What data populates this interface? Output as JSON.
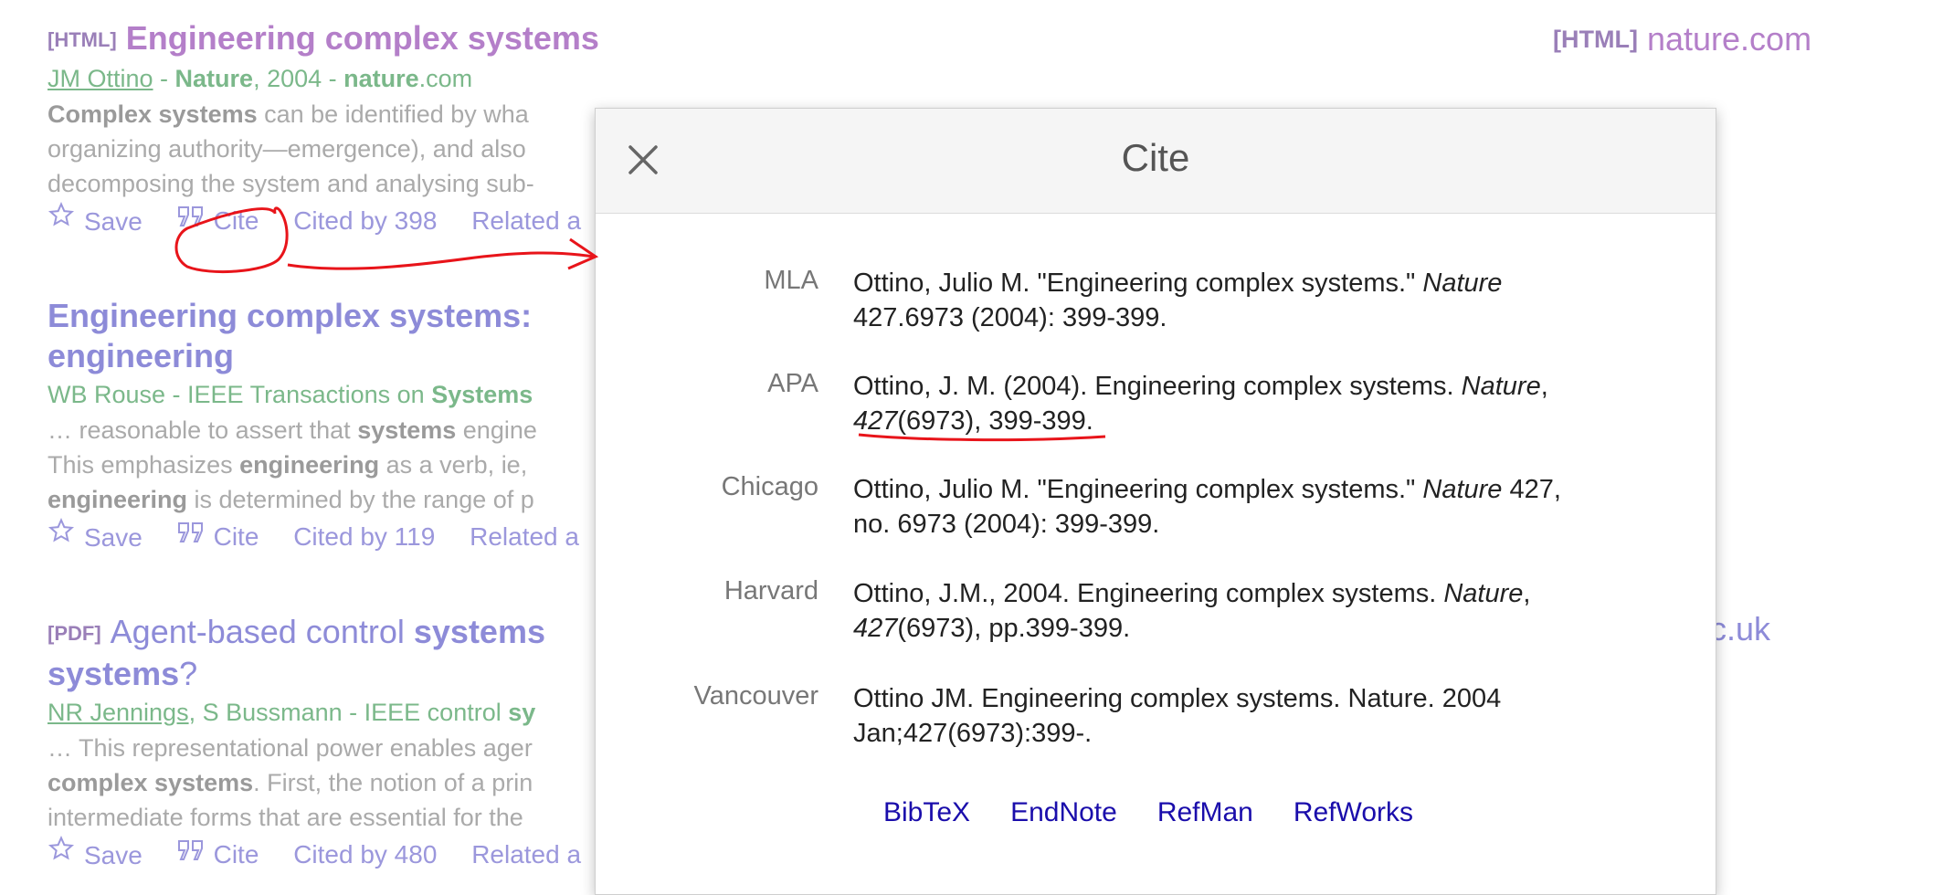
{
  "results": [
    {
      "tag": "[HTML]",
      "title": "Engineering complex systems",
      "author": "JM Ottino",
      "source_pre": " - ",
      "source_journal": "Nature",
      "source_year": ", 2004 - ",
      "source_domain_bold": "nature",
      "source_domain_rest": ".com",
      "snippet": [
        {
          "bold": "Complex systems",
          "text": " can be identified by wha"
        },
        {
          "bold": "",
          "text": "organizing authority—emergence), and also"
        },
        {
          "bold": "",
          "text": "decomposing the system and analysing sub-"
        }
      ],
      "save": "Save",
      "cite": "Cite",
      "cited_by": "Cited by 398",
      "related": "Related a",
      "side_tag": "[HTML]",
      "side_text": "nature.com"
    },
    {
      "title_line1": "Engineering complex systems:",
      "title_line2": "engineering",
      "meta_plain": "WB Rouse - IEEE Transactions on ",
      "meta_bold": "Systems",
      "snippet": [
        {
          "pre": "… reasonable to assert that ",
          "bold": "systems",
          "post": " engine"
        },
        {
          "pre": "This emphasizes ",
          "bold": "engineering",
          "post": " as a verb, ie,"
        },
        {
          "pre": "",
          "bold": "engineering",
          "post": " is determined by the range of p"
        }
      ],
      "save": "Save",
      "cite": "Cite",
      "cited_by": "Cited by 119",
      "related": "Related a"
    },
    {
      "tag": "[PDF]",
      "title_pre": "Agent-based control ",
      "title_bold": "systems",
      "title_line2_bold": "systems",
      "title_line2_rest": "?",
      "author1": "NR Jennings",
      "meta_rest": ", S Bussmann - IEEE control ",
      "meta_bold": "sy",
      "snippet": [
        {
          "pre": "… This representational power enables ager",
          "bold": "",
          "post": ""
        },
        {
          "pre": "",
          "bold": "complex systems",
          "post": ". First, the notion of a prin"
        },
        {
          "pre": "intermediate forms that are essential for the",
          "bold": "",
          "post": ""
        }
      ],
      "save": "Save",
      "cite": "Cite",
      "cited_by": "Cited by 480",
      "related": "Related a",
      "side_text": "ac.uk"
    }
  ],
  "dialog": {
    "title": "Cite",
    "citations": [
      {
        "style": "MLA",
        "l1a": "Ottino, Julio M. \"Engineering complex systems.\" ",
        "l1i": "Nature",
        "l1b": "",
        "l2i": "",
        "l2a": "427.6973 (2004): 399-399."
      },
      {
        "style": "APA",
        "l1a": "Ottino, J. M. (2004). Engineering complex systems. ",
        "l1i": "Nature",
        "l1b": ",",
        "l2i": "427",
        "l2a": "(6973), 399-399."
      },
      {
        "style": "Chicago",
        "l1a": "Ottino, Julio M. \"Engineering complex systems.\" ",
        "l1i": "Nature",
        "l1b": " 427,",
        "l2i": "",
        "l2a": "no. 6973 (2004): 399-399."
      },
      {
        "style": "Harvard",
        "l1a": "Ottino, J.M., 2004. Engineering complex systems. ",
        "l1i": "Nature",
        "l1b": ",",
        "l2i": "427",
        "l2a": "(6973), pp.399-399."
      },
      {
        "style": "Vancouver",
        "l1a": "Ottino JM. Engineering complex systems. Nature. 2004",
        "l1i": "",
        "l1b": "",
        "l2i": "",
        "l2a": "Jan;427(6973):399-."
      }
    ],
    "export_links": [
      "BibTeX",
      "EndNote",
      "RefMan",
      "RefWorks"
    ]
  },
  "icons": {
    "close": "close-icon",
    "star": "star-icon",
    "quote": "quote-icon"
  },
  "colors": {
    "annotation": "#e8141a",
    "link": "#1a0dab"
  }
}
